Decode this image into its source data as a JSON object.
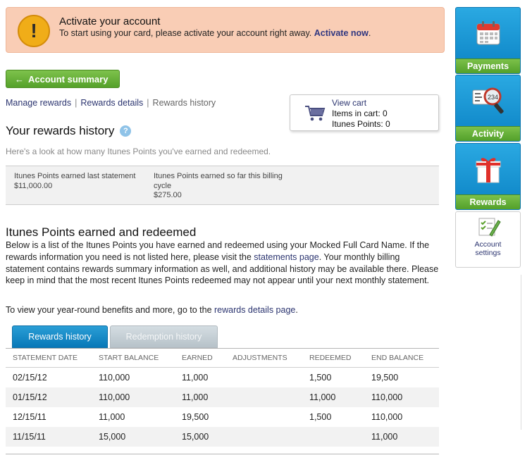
{
  "alert": {
    "title": "Activate your account",
    "message": "To start using your card, please activate your account right away.",
    "link": "Activate now",
    "icon": "exclamation-icon"
  },
  "nav": {
    "account_summary": "Account summary",
    "manage_rewards": "Manage rewards",
    "rewards_details": "Rewards details",
    "rewards_history": "Rewards history",
    "separator": "|"
  },
  "cart": {
    "view_cart": "View cart",
    "items_line": "Items in cart: 0",
    "points_line": "Itunes Points: 0"
  },
  "history": {
    "heading": "Your rewards history",
    "help": "?",
    "intro": "Here's a look at how many Itunes Points you've earned and redeemed."
  },
  "summary": {
    "last_statement_label": "Itunes Points earned last statement",
    "last_statement_value": "$11,000.00",
    "cycle_label": "Itunes Points earned so far this billing cycle",
    "cycle_value": "$275.00"
  },
  "earned": {
    "heading": "Itunes Points earned and redeemed",
    "para_part1": "Below is a list of the Itunes Points you have earned and redeemed using your Mocked Full Card Name. If the rewards information you need is not listed here, please visit the ",
    "para_link": "statements page",
    "para_part2": ". Your monthly billing statement contains rewards summary information as well, and additional history may be available there. Please keep in mind that the most recent Itunes Points redeemed may not appear until your next monthly statement.",
    "para2_text": "To view your year-round benefits and more, go to the ",
    "para2_link": "rewards details page",
    "para2_end": "."
  },
  "tabs": {
    "active": "Rewards history",
    "inactive": "Redemption history"
  },
  "table": {
    "headers": [
      "STATEMENT DATE",
      "START BALANCE",
      "EARNED",
      "ADJUSTMENTS",
      "REDEEMED",
      "END BALANCE"
    ],
    "rows": [
      [
        "02/15/12",
        "110,000",
        "11,000",
        "",
        "1,500",
        "19,500"
      ],
      [
        "01/15/12",
        "110,000",
        "11,000",
        "",
        "11,000",
        "110,000"
      ],
      [
        "12/15/11",
        "11,000",
        "19,500",
        "",
        "1,500",
        "110,000"
      ],
      [
        "11/15/11",
        "15,000",
        "15,000",
        "",
        "",
        "11,000"
      ]
    ]
  },
  "rail": {
    "payments": "Payments",
    "activity": "Activity",
    "rewards": "Rewards",
    "account_settings_line1": "Account",
    "account_settings_line2": "settings"
  },
  "colors": {
    "green": "#55a12a",
    "blue": "#0b82c4",
    "link": "#2c3570",
    "alert_bg": "#f9cdb5"
  }
}
